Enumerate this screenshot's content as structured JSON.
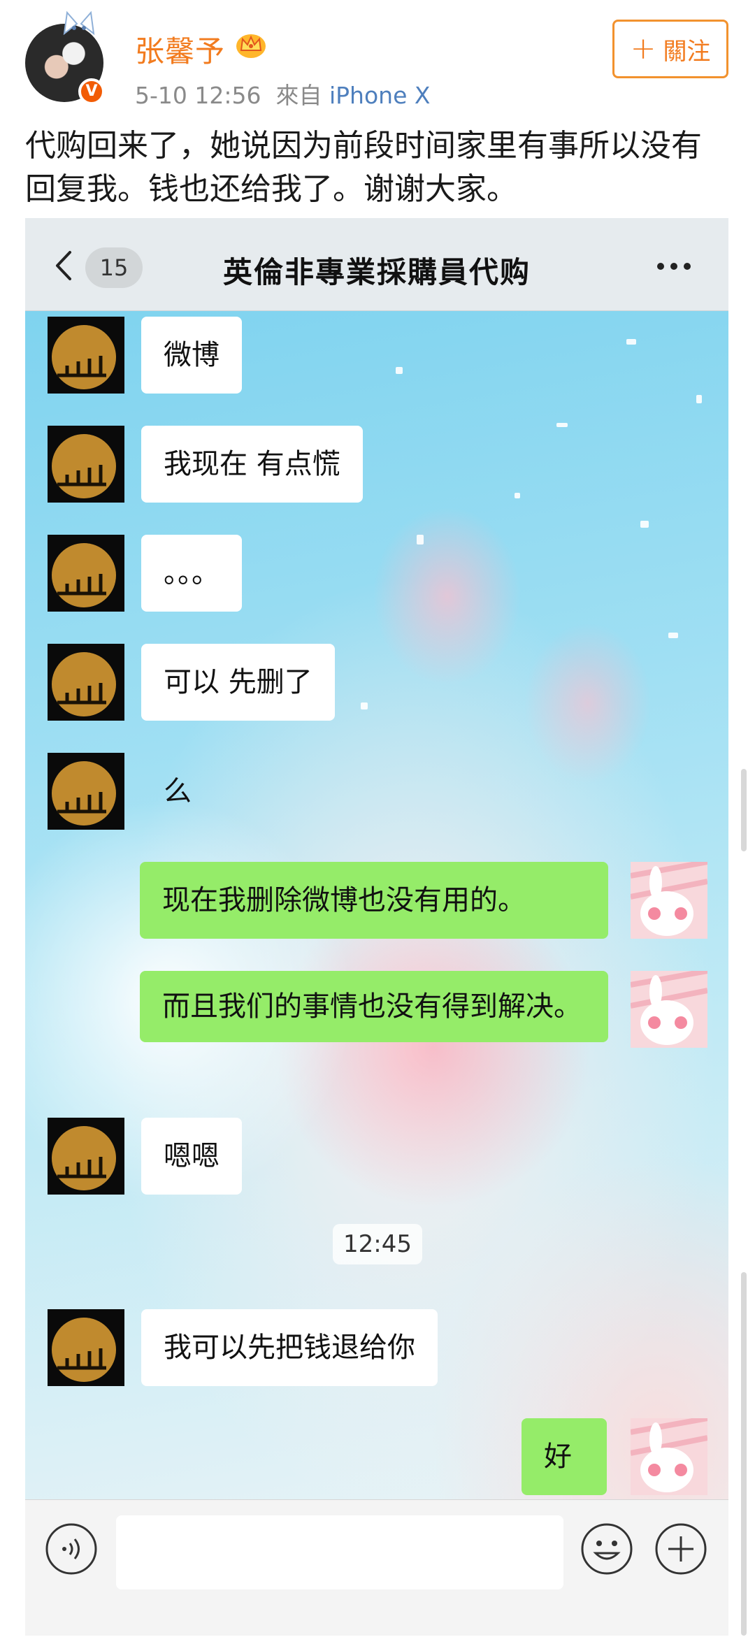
{
  "post": {
    "author_name": "张馨予",
    "meta_time": "5-10 12:56",
    "meta_from": "來自",
    "meta_device": "iPhone X",
    "follow_label": "關注",
    "verified_mark": "V",
    "text": "代购回来了，她说因为前段时间家里有事所以没有回复我。钱也还给我了。谢谢大家。"
  },
  "chat": {
    "unread_count": "15",
    "title": "英倫非專業採購員代购",
    "messages": [
      {
        "side": "left",
        "text": "微博"
      },
      {
        "side": "left",
        "text": "我现在 有点慌"
      },
      {
        "side": "left",
        "text": "。。。"
      },
      {
        "side": "left",
        "text": "可以 先删了"
      },
      {
        "side": "left",
        "text": "么"
      },
      {
        "side": "right",
        "text": "现在我删除微博也没有用的。"
      },
      {
        "side": "right",
        "text": "而且我们的事情也没有得到解决。"
      },
      {
        "side": "left",
        "text": "嗯嗯"
      },
      {
        "side": "time",
        "text": "12:45"
      },
      {
        "side": "left",
        "text": "我可以先把钱退给你"
      },
      {
        "side": "right",
        "text": "好"
      }
    ],
    "input_placeholder": ""
  },
  "colors": {
    "brand_orange": "#f27b1e",
    "link_blue": "#4e7fbd",
    "own_bubble_green": "#95ec69",
    "peer_bubble_white": "#ffffff"
  },
  "icons": [
    "cat-ears-icon",
    "verified-icon",
    "crown-icon",
    "plus-icon",
    "back-chevron-icon",
    "more-icon",
    "voice-icon",
    "emoji-icon",
    "add-icon"
  ]
}
